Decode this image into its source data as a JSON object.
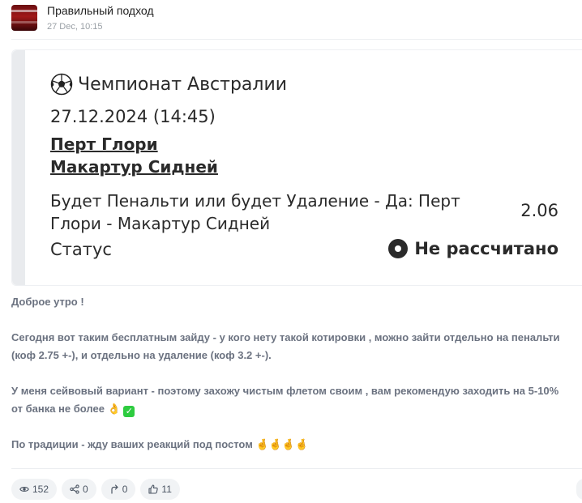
{
  "post": {
    "channel_name": "Правильный подход",
    "time": "27 Dec, 10:15"
  },
  "card": {
    "league": "Чемпионат Австралии",
    "date": "27.12.2024 (14:45)",
    "team_home": "Перт Глори",
    "team_away": "Макартур Сидней",
    "bet": "Будет Пенальти или будет Удаление - Да: Перт Глори - Макартур Сидней",
    "odds": "2.06",
    "status_label": "Статус",
    "status_value": "Не рассчитано"
  },
  "text": {
    "line1": "Доброе утро !",
    "line2": "Сегодня вот таким бесплатным зайду - у кого нету такой котировки , можно зайти отдельно на пенальти",
    "line3": "(коф 2.75 +-), и отдельно на удаление (коф 3.2 +-).",
    "line4": "У меня сейвовый вариант - поэтому захожу чистым флетом своим , вам рекомендую заходить на 5-10%",
    "line5": "от банка не более",
    "line5_emoji": "👌",
    "line6": "По традиции - жду ваших реакций под постом",
    "line6_emoji": "🤞🤞🤞🤞"
  },
  "actions": {
    "views": "152",
    "shares": "0",
    "forwards": "0",
    "likes": "11"
  },
  "icons": [
    "avatar",
    "soccer-ball-icon",
    "status-dot-icon",
    "eye-icon",
    "share-icon",
    "forward-icon",
    "thumbs-up-icon"
  ],
  "colors": {
    "check_green": "#2ecc40",
    "text_gray": "#6b7280"
  }
}
